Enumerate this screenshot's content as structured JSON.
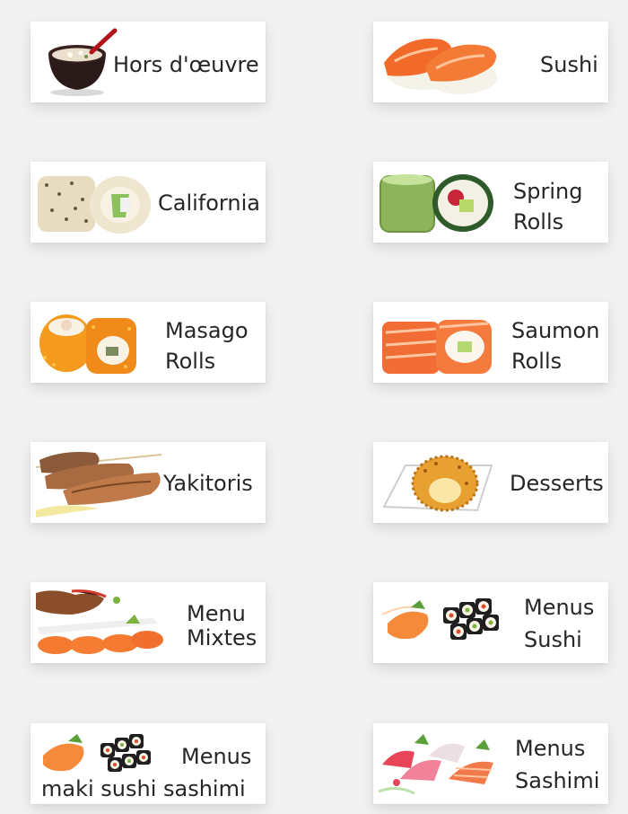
{
  "categories": [
    {
      "id": "hors",
      "lines": [
        "Hors d'œuvre"
      ],
      "thumb": "miso-soup-bowl-icon"
    },
    {
      "id": "sushi",
      "lines": [
        "Sushi"
      ],
      "thumb": "salmon-nigiri-icon"
    },
    {
      "id": "california",
      "lines": [
        "California"
      ],
      "thumb": "california-roll-icon"
    },
    {
      "id": "spring",
      "lines": [
        "Spring",
        "Rolls"
      ],
      "thumb": "spring-roll-icon"
    },
    {
      "id": "masago",
      "lines": [
        "Masago",
        "Rolls"
      ],
      "thumb": "masago-roll-icon"
    },
    {
      "id": "saumon",
      "lines": [
        "Saumon",
        "Rolls"
      ],
      "thumb": "salmon-roll-icon"
    },
    {
      "id": "yakitoris",
      "lines": [
        "Yakitoris"
      ],
      "thumb": "yakitori-skewers-icon"
    },
    {
      "id": "desserts",
      "lines": [
        "Desserts"
      ],
      "thumb": "dessert-plate-icon"
    },
    {
      "id": "menu-mixtes",
      "lines": [
        "Menu",
        "Mixtes"
      ],
      "thumb": "mixed-menu-platter-icon"
    },
    {
      "id": "menus-sushi",
      "lines": [
        "Menus",
        "Sushi"
      ],
      "thumb": "sushi-platter-icon"
    },
    {
      "id": "menus-maki",
      "lines": [
        "Menus",
        "maki sushi sashimi"
      ],
      "thumb": "maki-sushi-sashimi-platter-icon"
    },
    {
      "id": "menus-sashimi",
      "lines": [
        "Menus",
        "Sashimi"
      ],
      "thumb": "sashimi-platter-icon"
    }
  ]
}
